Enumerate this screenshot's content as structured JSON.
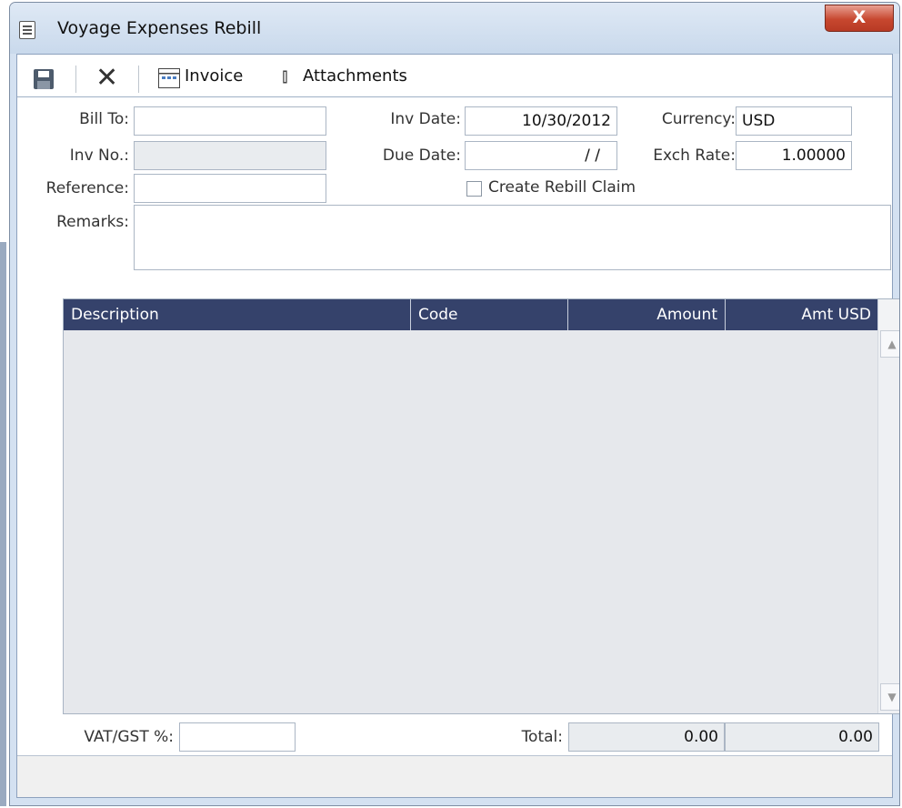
{
  "window": {
    "title": "Voyage Expenses Rebill",
    "close_glyph": "X"
  },
  "toolbar": {
    "delete_glyph": "✕",
    "invoice_label": "Invoice",
    "attachments_label": "Attachments",
    "clip_glyph": "⫾"
  },
  "form": {
    "bill_to": {
      "label": "Bill To:",
      "value": ""
    },
    "inv_no": {
      "label": "Inv No.:",
      "value": ""
    },
    "reference": {
      "label": "Reference:",
      "value": ""
    },
    "remarks": {
      "label": "Remarks:",
      "value": ""
    },
    "inv_date": {
      "label": "Inv Date:",
      "value": "10/30/2012"
    },
    "due_date": {
      "label": "Due Date:",
      "value": "/ /"
    },
    "create_rebill_claim": {
      "label": "Create Rebill Claim",
      "checked": false
    },
    "currency": {
      "label": "Currency:",
      "value": "USD"
    },
    "exch_rate": {
      "label": "Exch Rate:",
      "value": "1.00000"
    }
  },
  "grid": {
    "columns": [
      "Description",
      "Code",
      "Amount",
      "Amt USD"
    ],
    "rows": [],
    "scroll_up": "▲",
    "scroll_down": "▼"
  },
  "footer": {
    "vat_label": "VAT/GST %:",
    "vat_value": "",
    "total_label": "Total:",
    "total_amount": "0.00",
    "total_amt_usd": "0.00"
  },
  "icons": [
    "save-icon",
    "delete-icon",
    "invoice-icon",
    "paperclip-icon",
    "window-icon",
    "close-icon"
  ],
  "colors": {
    "grid_header": "#35426b",
    "close_button": "#c7472f",
    "frame": "#d4e1f1"
  }
}
